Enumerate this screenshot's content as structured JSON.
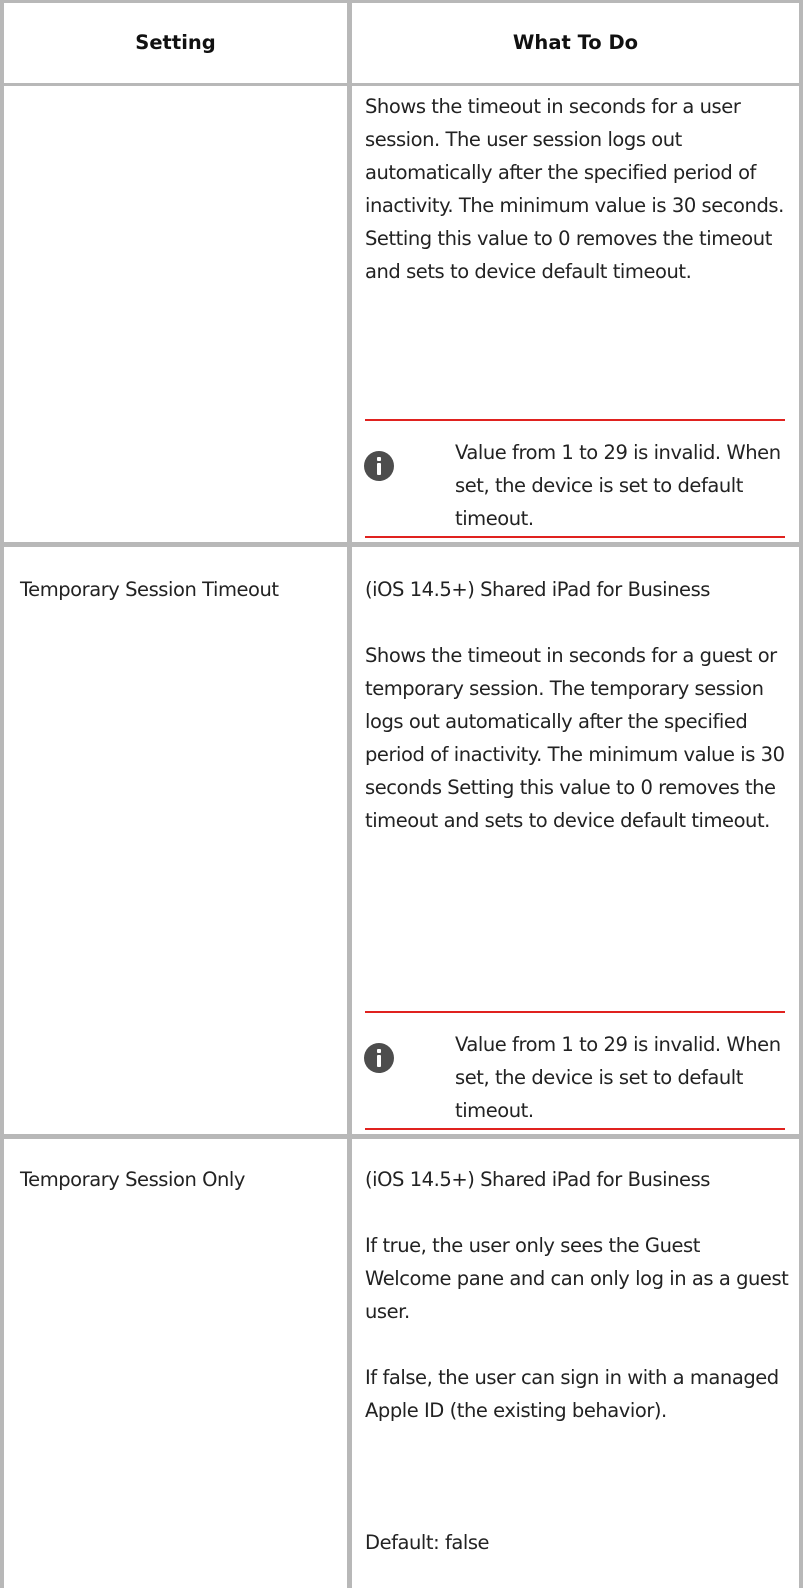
{
  "table": {
    "headers": {
      "setting": "Setting",
      "what_to_do": "What To Do"
    },
    "rows": [
      {
        "setting": "",
        "paragraphs": [
          "Shows the timeout in seconds for a user session. The user session logs out automatically after the specified period of inactivity. The minimum value is 30 seconds. Setting this value to 0 removes the timeout and sets to device default timeout."
        ],
        "note": "Value from 1 to 29 is invalid. When set, the device is set to default timeout."
      },
      {
        "setting": "Temporary Session Timeout",
        "paragraphs": [
          "(iOS 14.5+) Shared iPad for Business",
          "Shows the timeout in seconds for a guest or temporary session. The temporary session logs out automatically after the specified period of inactivity. The minimum value is 30 seconds Setting this value to 0 removes the timeout and sets to device default timeout."
        ],
        "note": "Value from 1 to 29 is invalid. When set, the device is set to default timeout."
      },
      {
        "setting": "Temporary Session Only",
        "paragraphs": [
          "(iOS 14.5+) Shared iPad for Business",
          "If true, the user only sees the Guest Welcome pane and can only log in as a guest user.",
          "If false, the user can sign in with a managed Apple ID (the existing behavior).",
          "Default: false"
        ],
        "note": ""
      }
    ]
  }
}
